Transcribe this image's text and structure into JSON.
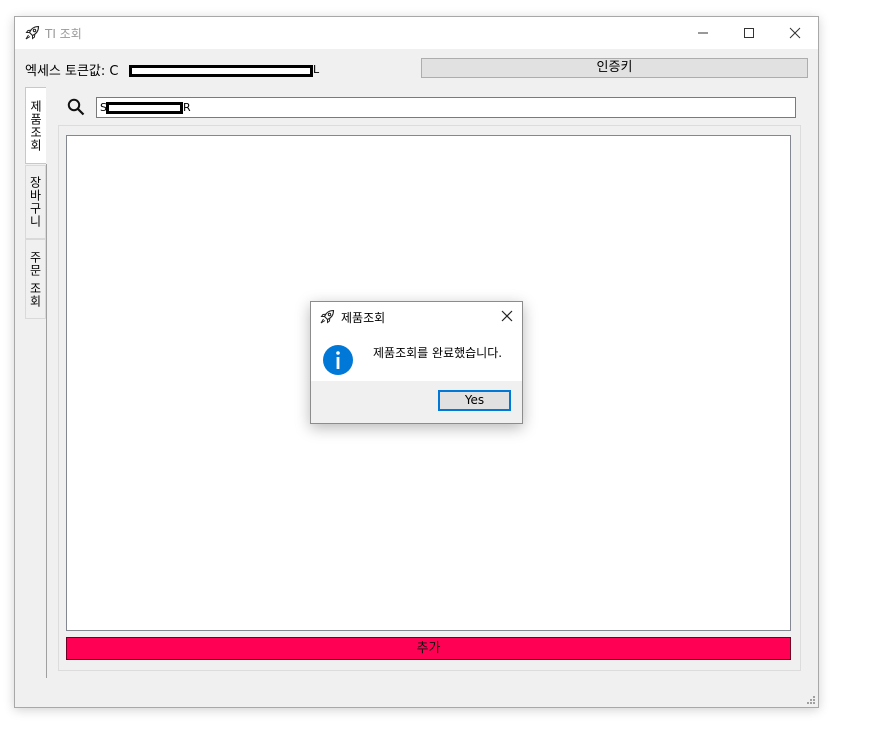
{
  "window": {
    "title": "TI 조회",
    "app_icon": "rocket-icon"
  },
  "header": {
    "token_label": "엑세스 토큰값: C",
    "token_tail": "L",
    "auth_button": "인증키"
  },
  "tabs": [
    {
      "label": "제품조회",
      "active": true
    },
    {
      "label": "장바구니",
      "active": false
    },
    {
      "label": "주문 조회",
      "active": false
    }
  ],
  "search": {
    "value_prefix": "S",
    "value_suffix": "R",
    "icon": "search-icon"
  },
  "main": {
    "add_button": "추가",
    "add_button_color": "#ff0055"
  },
  "dialog": {
    "title": "제품조회",
    "message": "제품조회를 완료했습니다.",
    "yes_button": "Yes",
    "icon": "info-icon",
    "accent_color": "#0078d7"
  }
}
